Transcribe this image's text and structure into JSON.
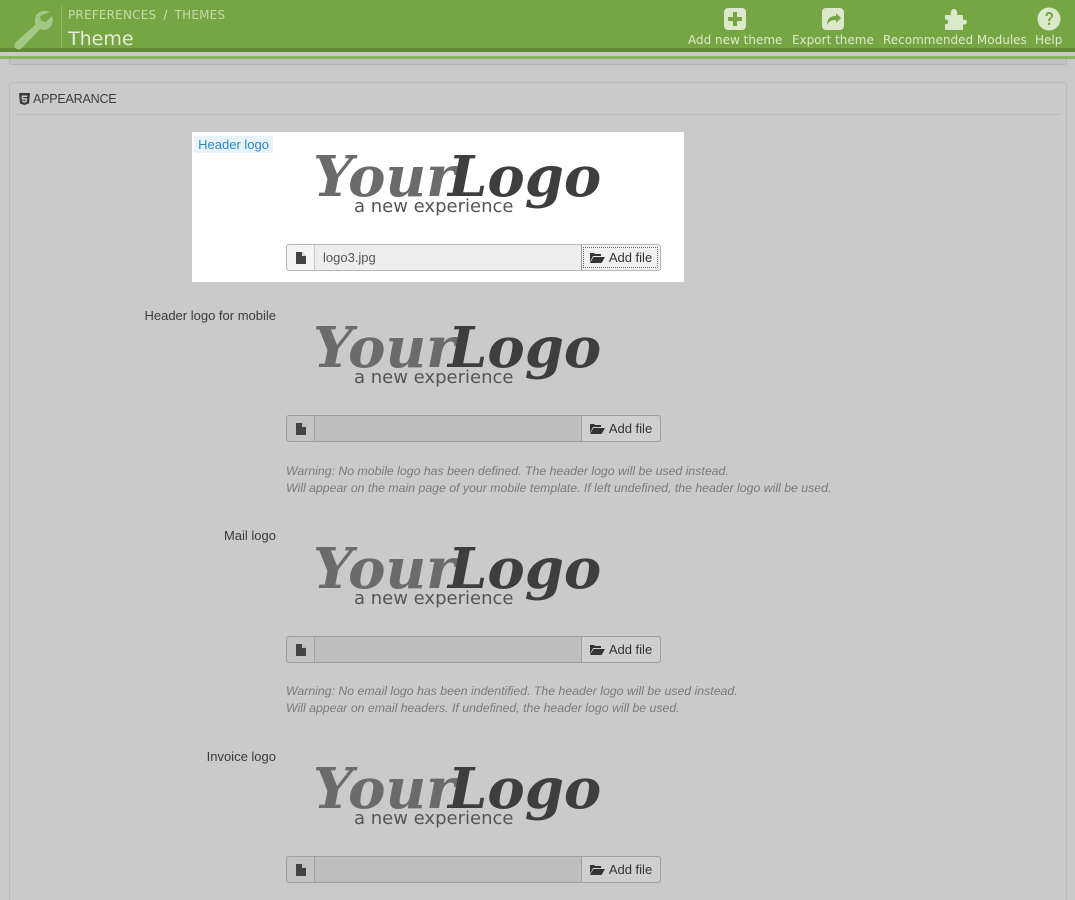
{
  "header": {
    "breadcrumb": [
      "PREFERENCES",
      "THEMES"
    ],
    "breadcrumb_separator": "/",
    "title": "Theme",
    "toolbar": [
      {
        "label": "Add new theme",
        "icon": "plus-square-icon"
      },
      {
        "label": "Export theme",
        "icon": "share-icon"
      },
      {
        "label": "Recommended Modules",
        "icon": "puzzle-icon"
      },
      {
        "label": "Help",
        "icon": "question-circle-icon"
      }
    ],
    "accent_color": "#76a544"
  },
  "panel": {
    "title": "APPEARANCE",
    "icon": "html5-icon"
  },
  "logo_image": {
    "word1": "Your",
    "word2": "Logo",
    "tagline": "a new experience"
  },
  "fields": [
    {
      "label": "Header logo",
      "file_name": "logo3.jpg",
      "button_label": "Add file",
      "help": []
    },
    {
      "label": "Header logo for mobile",
      "file_name": "",
      "button_label": "Add file",
      "help": [
        "Warning: No mobile logo has been defined. The header logo will be used instead.",
        "Will appear on the main page of your mobile template. If left undefined, the header logo will be used."
      ]
    },
    {
      "label": "Mail logo",
      "file_name": "",
      "button_label": "Add file",
      "help": [
        "Warning: No email logo has been indentified. The header logo will be used instead.",
        "Will appear on email headers. If undefined, the header logo will be used."
      ]
    },
    {
      "label": "Invoice logo",
      "file_name": "",
      "button_label": "Add file",
      "help": []
    }
  ]
}
